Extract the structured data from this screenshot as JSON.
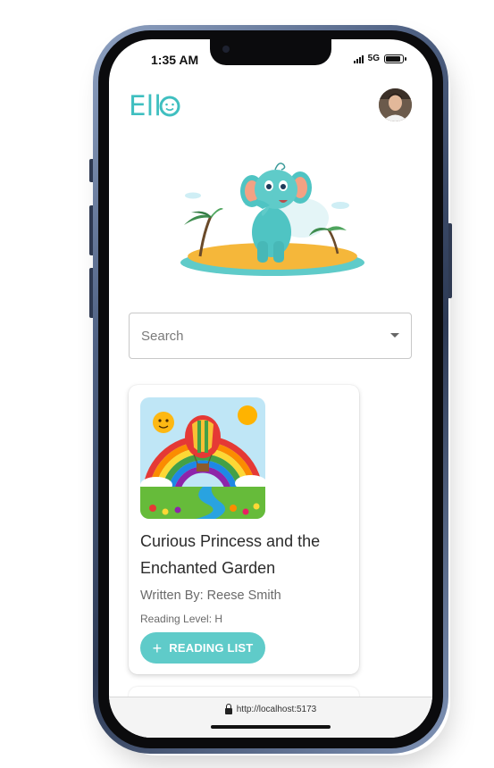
{
  "status_bar": {
    "time": "1:35 AM",
    "network": "5G",
    "battery_level": 0.9
  },
  "header": {
    "logo_text": "Ello",
    "brand_color": "#3fbfc0",
    "avatar": "user-avatar"
  },
  "search": {
    "placeholder": "Search"
  },
  "books": [
    {
      "title": "Curious Princess and the Enchanted Garden",
      "author": "Written By: Reese Smith",
      "level": "Reading Level: H",
      "button_label": "READING LIST",
      "button_color": "#5fcbc9"
    }
  ],
  "browser": {
    "url": "http://localhost:5173"
  }
}
